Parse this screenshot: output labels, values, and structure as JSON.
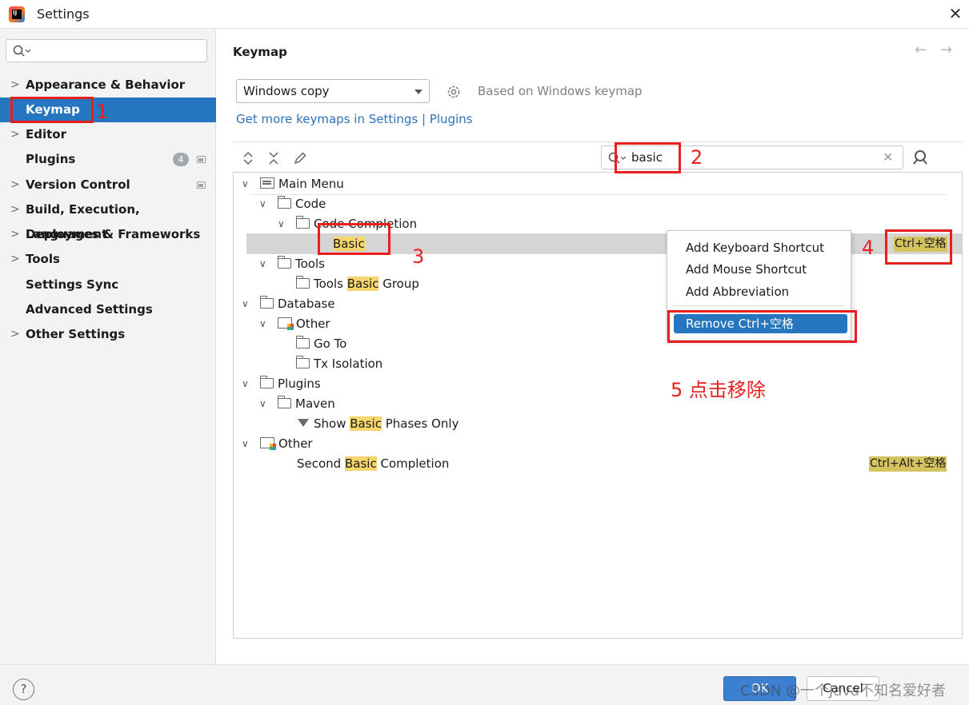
{
  "window": {
    "title": "Settings",
    "close_glyph": "✕"
  },
  "sidebar": {
    "search_placeholder": "",
    "items": [
      {
        "label": "Appearance & Behavior",
        "expandable": true
      },
      {
        "label": "Keymap",
        "selected": true
      },
      {
        "label": "Editor",
        "expandable": true
      },
      {
        "label": "Plugins",
        "badge": "4"
      },
      {
        "label": "Version Control",
        "expandable": true
      },
      {
        "label": "Build, Execution, Deployment",
        "expandable": true
      },
      {
        "label": "Languages & Frameworks",
        "expandable": true
      },
      {
        "label": "Tools",
        "expandable": true
      },
      {
        "label": "Settings Sync"
      },
      {
        "label": "Advanced Settings"
      },
      {
        "label": "Other Settings",
        "expandable": true
      }
    ]
  },
  "main": {
    "title": "Keymap",
    "keymap_select": "Windows copy",
    "based_on": "Based on Windows keymap",
    "get_more_link": "Get more keymaps in Settings | Plugins",
    "search_value": "basic",
    "tree": {
      "main_menu": "Main Menu",
      "code": "Code",
      "code_completion": "Code Completion",
      "basic": "Basic",
      "basic_shortcut": "Ctrl+空格",
      "tools": "Tools",
      "tools_basic_group_pre": "Tools ",
      "tools_basic_group_hl": "Basic",
      "tools_basic_group_post": " Group",
      "database": "Database",
      "other1": "Other",
      "go_to": "Go To",
      "tx_isolation": "Tx Isolation",
      "plugins": "Plugins",
      "maven": "Maven",
      "show_basic_pre": "Show ",
      "show_basic_hl": "Basic",
      "show_basic_post": " Phases Only",
      "other2": "Other",
      "second_pre": "Second ",
      "second_hl": "Basic",
      "second_post": " Completion",
      "second_shortcut": "Ctrl+Alt+空格"
    }
  },
  "context_menu": {
    "items": [
      "Add Keyboard Shortcut",
      "Add Mouse Shortcut",
      "Add Abbreviation"
    ],
    "active": "Remove Ctrl+空格"
  },
  "annotations": {
    "n1": "1",
    "n2": "2",
    "n3": "3",
    "n4": "4",
    "n5": "5 点击移除"
  },
  "footer": {
    "help": "?",
    "ok": "OK",
    "cancel": "Cancel",
    "watermark": "CSDN @一个Java不知名爱好者"
  },
  "colors": {
    "accent": "#2675bf",
    "annotation": "#e8201d",
    "highlight": "#f6d56c"
  }
}
